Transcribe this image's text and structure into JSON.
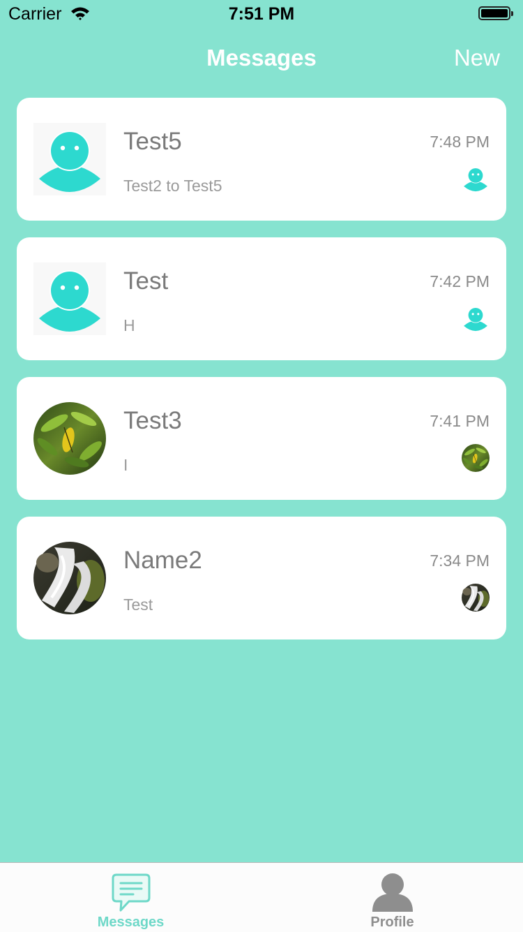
{
  "status": {
    "carrier": "Carrier",
    "time": "7:51 PM"
  },
  "nav": {
    "title": "Messages",
    "new_label": "New"
  },
  "conversations": [
    {
      "name": "Test5",
      "preview": "Test2 to Test5",
      "time": "7:48 PM",
      "avatar": "default-avatar-icon"
    },
    {
      "name": "Test",
      "preview": "H",
      "time": "7:42 PM",
      "avatar": "default-avatar-icon"
    },
    {
      "name": "Test3",
      "preview": "I",
      "time": "7:41 PM",
      "avatar": "leaf-photo"
    },
    {
      "name": "Name2",
      "preview": "Test",
      "time": "7:34 PM",
      "avatar": "waterfall-photo"
    }
  ],
  "tabs": [
    {
      "label": "Messages",
      "icon": "chat-bubble-icon",
      "active": true
    },
    {
      "label": "Profile",
      "icon": "person-icon",
      "active": false
    }
  ],
  "colors": {
    "background": "#86e3d0",
    "accent": "#2dd9cf",
    "tab_active": "#6ed8c8",
    "tab_inactive": "#8e8e8e"
  }
}
